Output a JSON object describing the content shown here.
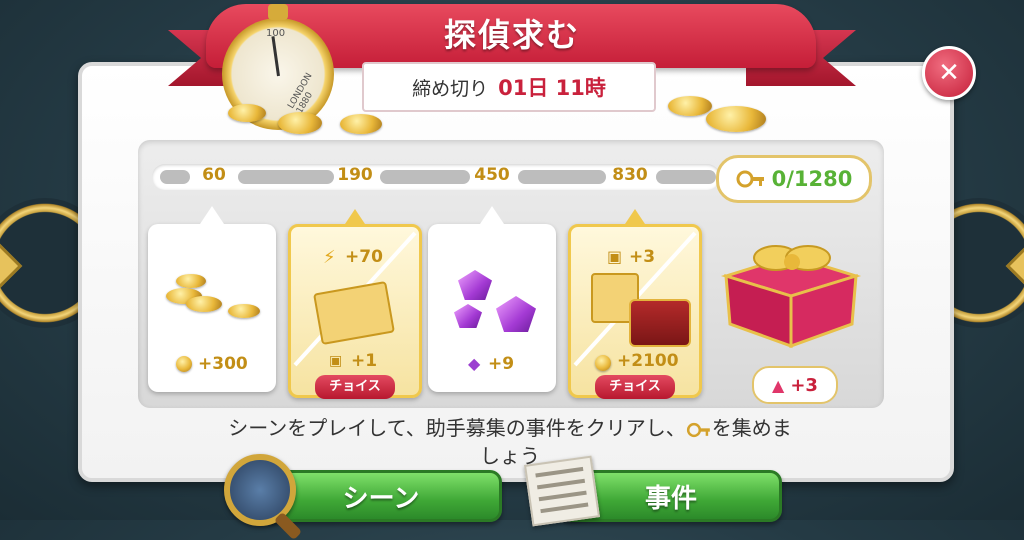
{
  "header": {
    "title": "探偵求む",
    "deadline_label": "締め切り",
    "deadline_value": "01日 11時"
  },
  "stopwatch": {
    "number": "100",
    "brand": "LONDON 1880"
  },
  "progress": {
    "milestones": [
      "60",
      "190",
      "450",
      "830"
    ],
    "total": "0/1280",
    "current": 0,
    "max": 1280
  },
  "rewards": [
    {
      "amount": "+300",
      "icon": "coin-icon"
    },
    {
      "top_amount": "+70",
      "bottom_amount": "+1",
      "choice_label": "チョイス",
      "icons": [
        "energy-icon",
        "ticket-icon"
      ]
    },
    {
      "amount": "+9",
      "icon": "gem-icon"
    },
    {
      "top_amount": "+3",
      "bottom_amount": "+2100",
      "choice_label": "チョイス",
      "icons": [
        "ticket-icon",
        "treasure-chest-icon"
      ]
    }
  ],
  "grand_prize": {
    "badge": "+3",
    "icon": "gift-chest-icon"
  },
  "description": {
    "line1": "シーンをプレイして、助手募集の事件をクリアし、",
    "line1_end": "を集めま",
    "line2": "しょう"
  },
  "buttons": {
    "scene": "シーン",
    "case": "事件"
  },
  "colors": {
    "accent_red": "#c51e38",
    "gold": "#c28e16",
    "green": "#3fa836",
    "progress_green": "#58b236"
  }
}
